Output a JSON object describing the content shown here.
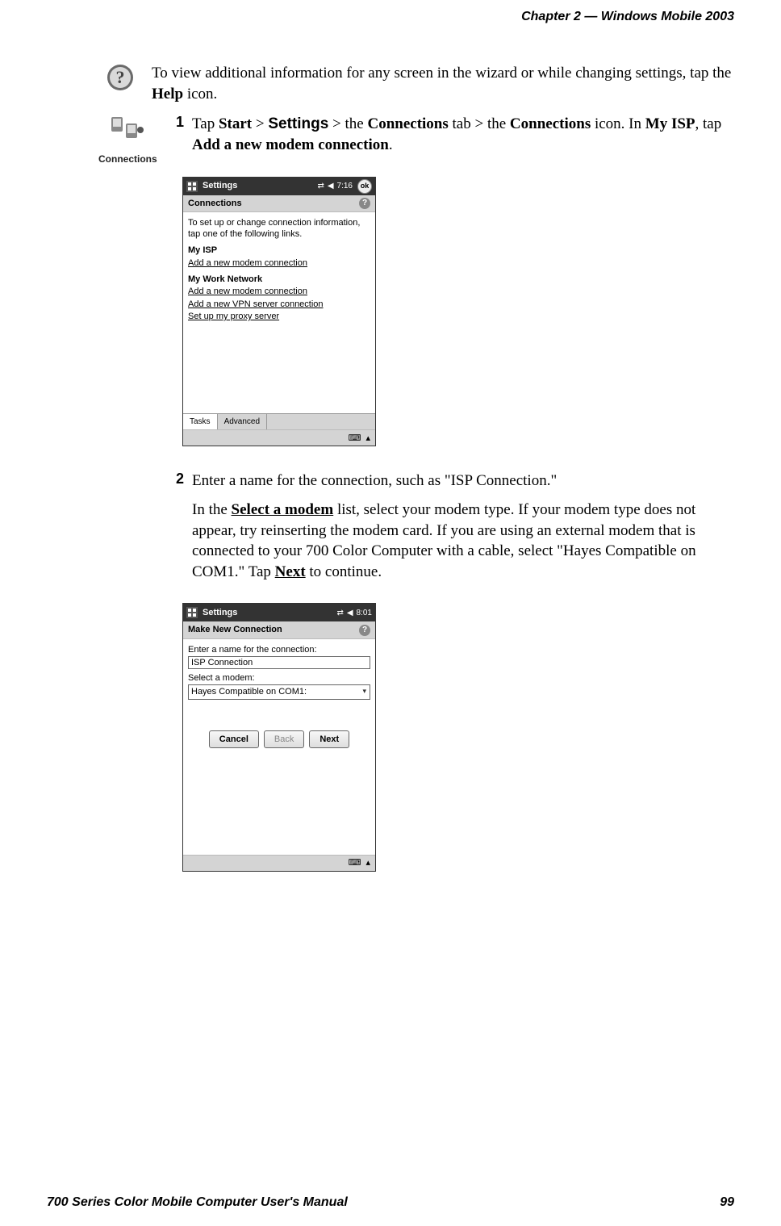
{
  "header": {
    "right": "Chapter  2  —    Windows Mobile 2003"
  },
  "footer": {
    "left": "700 Series Color Mobile Computer User's Manual",
    "right": "99"
  },
  "help_note": {
    "pre": "To view additional information for any screen in the wizard or while changing settings, tap the ",
    "bold": "Help",
    "post": " icon."
  },
  "conn_icon_label": "Connections",
  "step1": {
    "num": "1",
    "t1": "Tap ",
    "b1": "Start",
    "t2": " > ",
    "sb1": "Settings",
    "t3": " > the ",
    "b2": "Connections",
    "t4": " tab > the ",
    "b3": "Connections",
    "t5": " icon. In ",
    "b4": "My ISP",
    "t6": ", tap ",
    "b5": "Add a new modem connection",
    "t7": "."
  },
  "pda1": {
    "title": "Settings",
    "time": "7:16",
    "ok": "ok",
    "subhead": "Connections",
    "intro": "To set up or change connection information, tap one of the following links.",
    "isp_label": "My ISP",
    "isp_link": "Add a new modem connection",
    "work_label": "My Work Network",
    "work_link1": "Add a new modem connection",
    "work_link2": "Add a new VPN server connection",
    "work_link3": "Set up my proxy server",
    "tab_tasks": "Tasks",
    "tab_advanced": "Advanced"
  },
  "step2": {
    "num": "2",
    "line1": "Enter a name for the connection, such as \"ISP Connection.\"",
    "p2a": "In the ",
    "p2b": "Select a modem",
    "p2c": " list, select your modem type. If your modem type does not appear, try reinserting the modem card. If you are using an external modem that is connected to your 700 Color Computer with a cable, select \"Hayes Compatible on COM1.\" Tap ",
    "p2d": "Next",
    "p2e": " to continue."
  },
  "pda2": {
    "title": "Settings",
    "time": "8:01",
    "subhead": "Make New Connection",
    "label1": "Enter a name for the connection:",
    "input_value": "ISP Connection",
    "label2": "Select a modem:",
    "select_value": "Hayes Compatible on COM1:",
    "btn_cancel": "Cancel",
    "btn_back": "Back",
    "btn_next": "Next"
  }
}
